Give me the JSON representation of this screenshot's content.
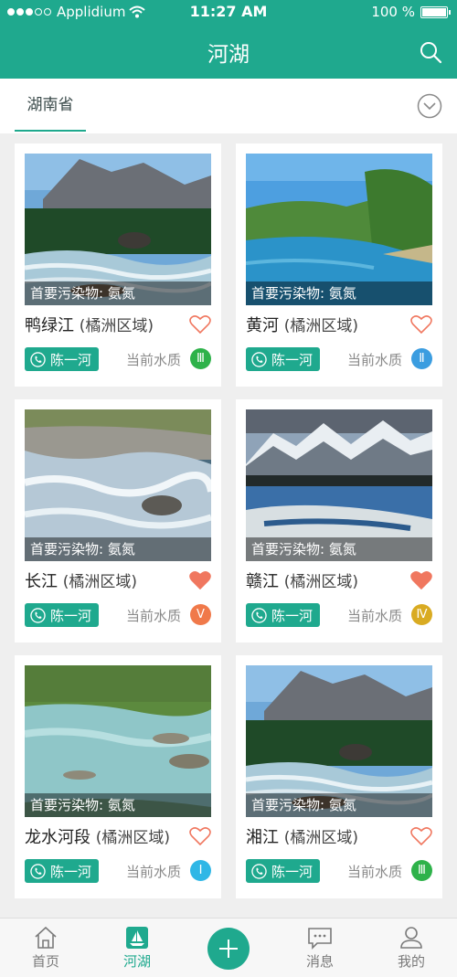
{
  "status_bar": {
    "carrier": "Applidium",
    "time": "11:27 AM",
    "battery": "100 %",
    "signal_bars_filled": 3,
    "signal_bars_total": 5
  },
  "nav": {
    "title": "河湖"
  },
  "filter": {
    "region": "湖南省"
  },
  "cards": [
    {
      "name": "鸭绿江",
      "region": "(橘洲区域)",
      "pollutant": "首要污染物: 氨氮",
      "keeper": "陈一河",
      "quality_label": "当前水质",
      "grade": "Ⅲ",
      "grade_color": "#2eb24a",
      "favorited": false,
      "image": "mountain-forest-river"
    },
    {
      "name": "黄河",
      "region": "(橘洲区域)",
      "pollutant": "首要污染物: 氨氮",
      "keeper": "陈一河",
      "quality_label": "当前水质",
      "grade": "Ⅱ",
      "grade_color": "#3b9de0",
      "favorited": false,
      "image": "green-valley-river"
    },
    {
      "name": "长江",
      "region": "(橘洲区域)",
      "pollutant": "首要污染物: 氨氮",
      "keeper": "陈一河",
      "quality_label": "当前水质",
      "grade": "Ⅴ",
      "grade_color": "#f0794a",
      "favorited": true,
      "image": "rapids"
    },
    {
      "name": "赣江",
      "region": "(橘洲区域)",
      "pollutant": "首要污染物: 氨氮",
      "keeper": "陈一河",
      "quality_label": "当前水质",
      "grade": "Ⅳ",
      "grade_color": "#d9ab22",
      "favorited": true,
      "image": "snow-mountain-river"
    },
    {
      "name": "龙水河段",
      "region": "(橘洲区域)",
      "pollutant": "首要污染物: 氨氮",
      "keeper": "陈一河",
      "quality_label": "当前水质",
      "grade": "Ⅰ",
      "grade_color": "#2fb7e6",
      "favorited": false,
      "image": "grassland-stream"
    },
    {
      "name": "湘江",
      "region": "(橘洲区域)",
      "pollutant": "首要污染物: 氨氮",
      "keeper": "陈一河",
      "quality_label": "当前水质",
      "grade": "Ⅲ",
      "grade_color": "#2eb24a",
      "favorited": false,
      "image": "mountain-forest-river"
    }
  ],
  "tabbar": [
    {
      "label": "首页",
      "icon": "home-icon",
      "active": false
    },
    {
      "label": "河湖",
      "icon": "boat-icon",
      "active": true
    },
    {
      "label": "",
      "icon": "plus-icon",
      "active": false
    },
    {
      "label": "消息",
      "icon": "message-icon",
      "active": false
    },
    {
      "label": "我的",
      "icon": "user-icon",
      "active": false
    }
  ],
  "colors": {
    "primary": "#1fa98e",
    "heart_filled": "#f0775f",
    "heart_outline": "#f0775f"
  }
}
